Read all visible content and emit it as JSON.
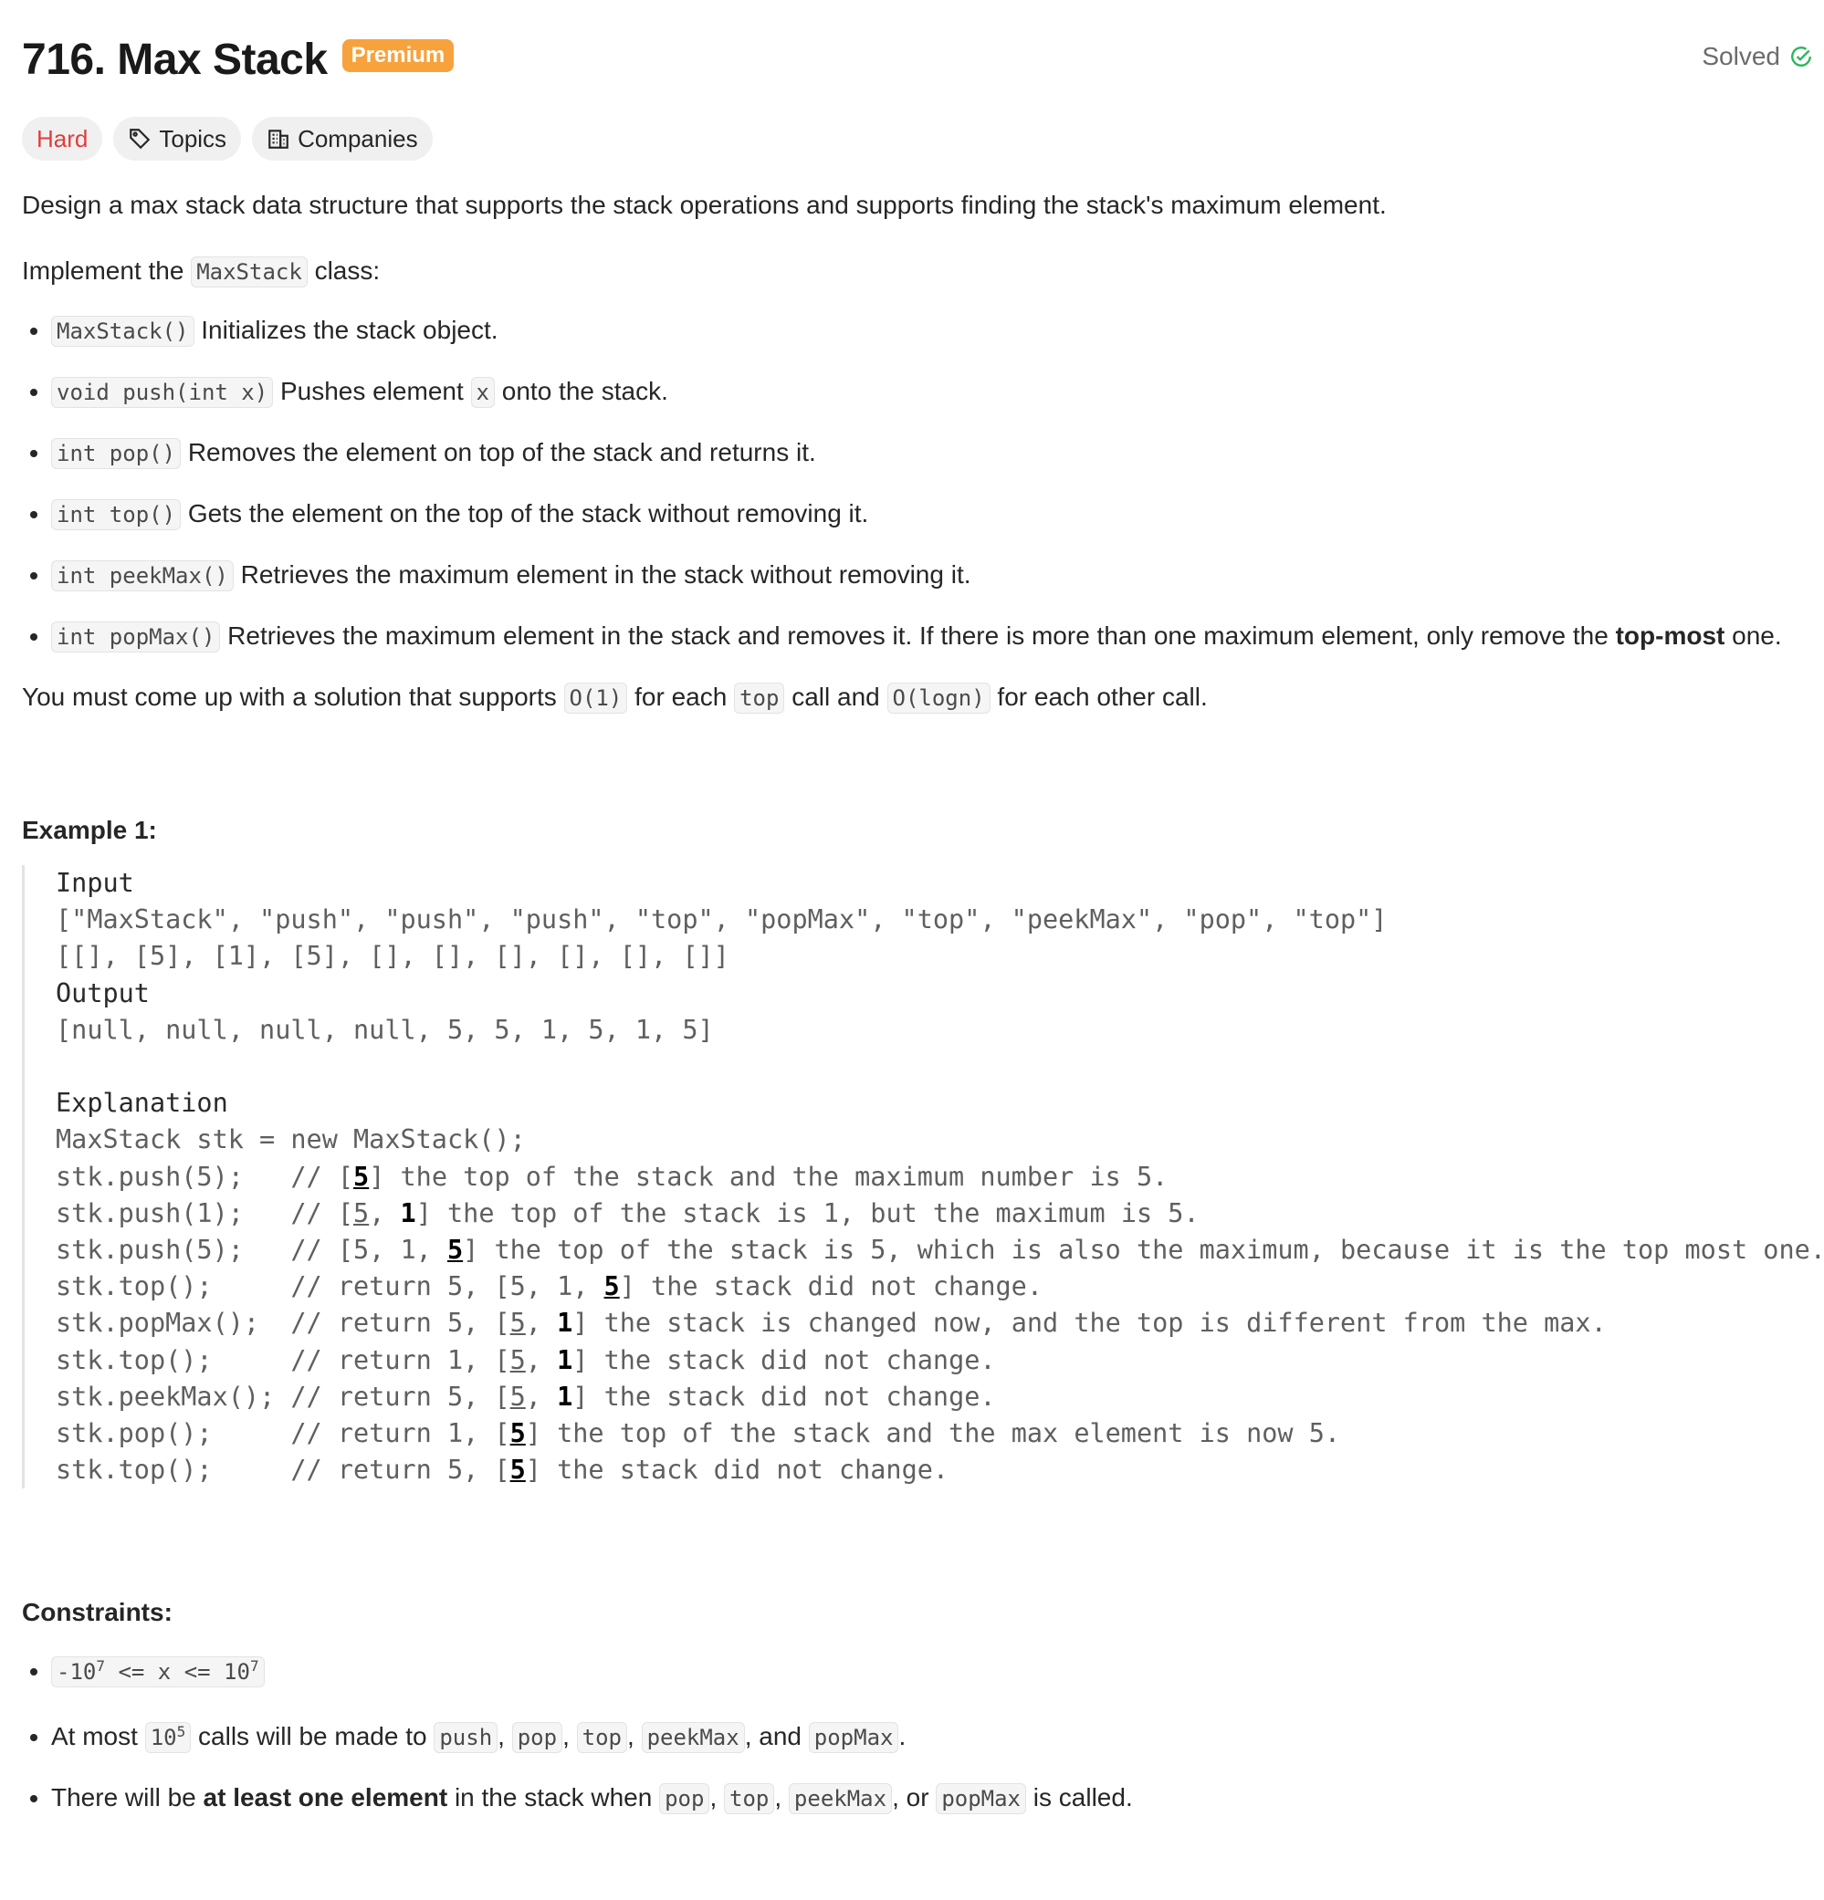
{
  "header": {
    "title": "716. Max Stack",
    "badge": "Premium",
    "status": "Solved"
  },
  "chips": {
    "difficulty": "Hard",
    "topics": "Topics",
    "companies": "Companies"
  },
  "description": {
    "line1": "Design a max stack data structure that supports the stack operations and supports finding the stack's maximum element.",
    "impl_pre": "Implement the ",
    "impl_code": "MaxStack",
    "impl_post": " class:",
    "methods": [
      {
        "code": "MaxStack()",
        "text": " Initializes the stack object."
      },
      {
        "code": "void push(int x)",
        "text_pre": " Pushes element ",
        "code2": "x",
        "text_post": " onto the stack."
      },
      {
        "code": "int pop()",
        "text": " Removes the element on top of the stack and returns it."
      },
      {
        "code": "int top()",
        "text": " Gets the element on the top of the stack without removing it."
      },
      {
        "code": "int peekMax()",
        "text": " Retrieves the maximum element in the stack without removing it."
      },
      {
        "code": "int popMax()",
        "text_pre": " Retrieves the maximum element in the stack and removes it. If there is more than one maximum element, only remove the ",
        "bold": "top-most",
        "text_post": " one."
      }
    ],
    "must": {
      "p1": "You must come up with a solution that supports ",
      "c1": "O(1)",
      "p2": " for each ",
      "c2": "top",
      "p3": " call and ",
      "c3": "O(logn)",
      "p4": " for each other call."
    }
  },
  "example": {
    "title": "Example 1:",
    "input_label": "Input",
    "input_line1": "[\"MaxStack\", \"push\", \"push\", \"push\", \"top\", \"popMax\", \"top\", \"peekMax\", \"pop\", \"top\"]",
    "input_line2": "[[], [5], [1], [5], [], [], [], [], [], []]",
    "output_label": "Output",
    "output_line": "[null, null, null, null, 5, 5, 1, 5, 1, 5]",
    "explanation_label": "Explanation",
    "explanation_first": "MaxStack stk = new MaxStack();"
  },
  "constraints": {
    "title": "Constraints:",
    "c1_a": "-10",
    "c1_exp": "7",
    "c1_b": " <= x <= 10",
    "c2_pre": "At most ",
    "c2_num": "10",
    "c2_exp": "5",
    "c2_mid": " calls will be made to ",
    "c2_list": [
      "push",
      "pop",
      "top",
      "peekMax",
      "popMax"
    ],
    "c3_pre": "There will be ",
    "c3_bold": "at least one element",
    "c3_mid": " in the stack when ",
    "c3_list": [
      "pop",
      "top",
      "peekMax",
      "popMax"
    ],
    "c3_post": " is called."
  },
  "colors": {
    "premium": "#f7a23c",
    "hard": "#e03d3d",
    "solved_check": "#2db55d"
  }
}
